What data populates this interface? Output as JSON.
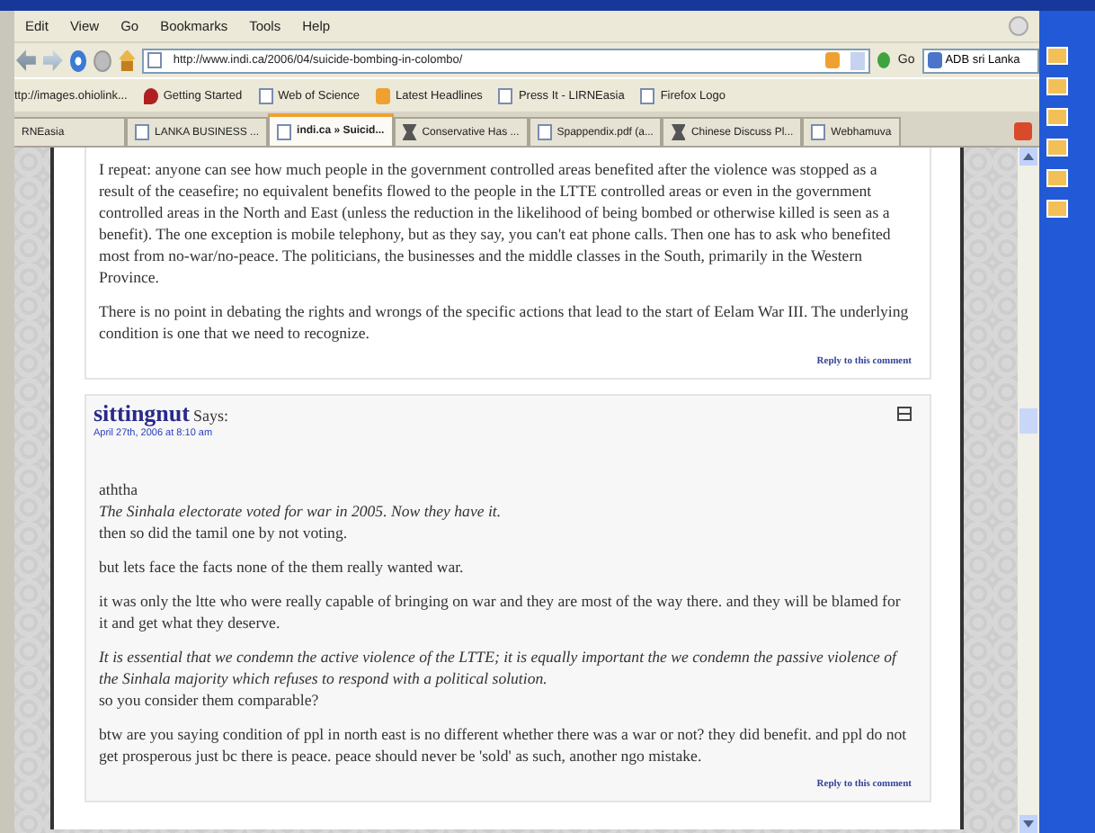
{
  "menu": [
    {
      "label": "Edit"
    },
    {
      "label": "View"
    },
    {
      "label": "Go"
    },
    {
      "label": "Bookmarks"
    },
    {
      "label": "Tools"
    },
    {
      "label": "Help"
    }
  ],
  "navigation": {
    "address": "http://www.indi.ca/2006/04/suicide-bombing-in-colombo/",
    "go": "Go",
    "search": "ADB sri Lanka"
  },
  "bookmarks": [
    {
      "label": "ttp://images.ohiolink...",
      "kind": "none"
    },
    {
      "label": "Getting Started",
      "kind": "bird"
    },
    {
      "label": "Web of Science",
      "kind": "page"
    },
    {
      "label": "Latest Headlines",
      "kind": "feed"
    },
    {
      "label": "Press It - LIRNEasia",
      "kind": "page"
    },
    {
      "label": "Firefox Logo",
      "kind": "page"
    }
  ],
  "tabs": [
    {
      "label": "RNEasia",
      "kind": "none",
      "selected": false
    },
    {
      "label": "LANKA BUSINESS ...",
      "kind": "page",
      "selected": false
    },
    {
      "label": "indi.ca » Suicid...",
      "kind": "page",
      "selected": true
    },
    {
      "label": "Conservative Has ...",
      "kind": "logo",
      "selected": false
    },
    {
      "label": "Spappendix.pdf (a...",
      "kind": "page",
      "selected": false
    },
    {
      "label": "Chinese Discuss Pl...",
      "kind": "logo",
      "selected": false
    },
    {
      "label": "Webhamuva",
      "kind": "page",
      "selected": false
    }
  ],
  "comments": [
    {
      "paragraphs": [
        [
          {
            "text": "I repeat: anyone can see how much people in the government controlled areas benefited after the violence was stopped as a result of the ceasefire; no equivalent benefits flowed to the people in the LTTE controlled areas or even in the government controlled areas in the North and East (unless the reduction in the likelihood of being bombed or otherwise killed is seen as a benefit). The one exception is mobile telephony, but as they say, you can't eat phone calls. Then one has to ask who benefited most from no-war/no-peace. The politicians, the businesses and the middle classes in the South, primarily in the Western Province.",
            "italic": false
          }
        ],
        [
          {
            "text": "There is no point in debating the rights and wrongs of the specific actions that lead to the start of Eelam War III. The underlying condition is one that we need to recognize.",
            "italic": false
          }
        ]
      ],
      "reply": "Reply to this comment"
    },
    {
      "author": "sittingnut",
      "says": "Says:",
      "date": "April 27th, 2006 at 8:10 am",
      "paragraphs": [
        [
          {
            "text": "aththa",
            "italic": false
          },
          {
            "text": "The Sinhala electorate voted for war in 2005. Now they have it.",
            "italic": true
          },
          {
            "text": "then so did the tamil one by not voting.",
            "italic": false
          }
        ],
        [
          {
            "text": "but lets face the facts none of the them really wanted war.",
            "italic": false
          }
        ],
        [
          {
            "text": "it was only the ltte who were really capable of bringing on war and they are most of the way there. and they will be blamed for it and get what they deserve.",
            "italic": false
          }
        ],
        [
          {
            "text": "It is essential that we condemn the active violence of the LTTE; it is equally important the we condemn the passive violence of the Sinhala majority which refuses to respond with a political solution.",
            "italic": true
          },
          {
            "text": "so you consider them comparable?",
            "italic": false
          }
        ],
        [
          {
            "text": "btw are you saying condition of ppl in north east is no different whether there was a war or not? they did benefit. and ppl do not get prosperous just bc there is peace. peace should never be 'sold' as such, another ngo mistake.",
            "italic": false
          }
        ]
      ],
      "reply": "Reply to this comment"
    }
  ]
}
